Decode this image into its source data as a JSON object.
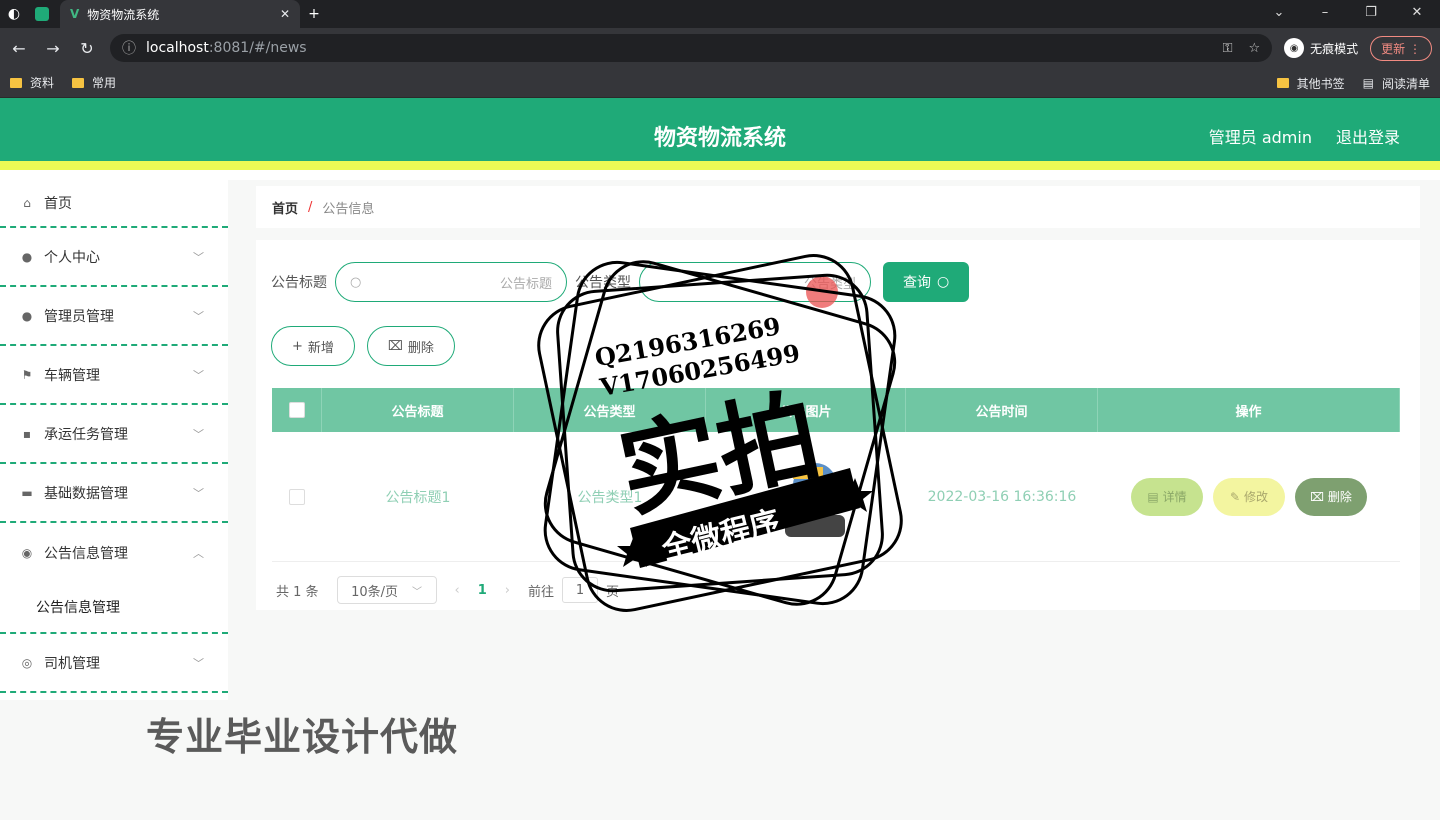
{
  "browser": {
    "tab_title": "物资物流系统",
    "new_tab": "+",
    "url_host": "localhost",
    "url_rest": ":8081/#/news",
    "incognito": "无痕模式",
    "update": "更新",
    "bookmarks": [
      "资料",
      "常用"
    ],
    "bookmarks_right": [
      "其他书签",
      "阅读清单"
    ]
  },
  "header": {
    "title": "物资物流系统",
    "user": "管理员 admin",
    "logout": "退出登录"
  },
  "sidebar": {
    "items": [
      {
        "label": "首页",
        "icon": "home-icon"
      },
      {
        "label": "个人中心",
        "icon": "user-icon"
      },
      {
        "label": "管理员管理",
        "icon": "admin-icon"
      },
      {
        "label": "车辆管理",
        "icon": "flag-icon"
      },
      {
        "label": "承运任务管理",
        "icon": "chat-icon"
      },
      {
        "label": "基础数据管理",
        "icon": "box-icon"
      },
      {
        "label": "公告信息管理",
        "icon": "bulb-icon"
      }
    ],
    "sub_item": "公告信息管理",
    "last_item": {
      "label": "司机管理",
      "icon": "compass-icon"
    }
  },
  "breadcrumb": {
    "home": "首页",
    "sep": "/",
    "current": "公告信息"
  },
  "search": {
    "label1": "公告标题",
    "placeholder1": "公告标题",
    "label2": "公告类型",
    "placeholder2": "公告类型",
    "query": "查询"
  },
  "actions": {
    "add": "新增",
    "delete": "删除"
  },
  "table": {
    "headers": [
      "公告标题",
      "公告类型",
      "公告图片",
      "公告时间",
      "操作"
    ],
    "rows": [
      {
        "title": "公告标题1",
        "type": "公告类型1",
        "time": "2022-03-16 16:36:16"
      }
    ],
    "op_detail": "详情",
    "op_edit": "修改",
    "op_delete": "删除"
  },
  "pagination": {
    "total": "共 1 条",
    "page_size": "10条/页",
    "current": "1",
    "goto": "前往",
    "goto_value": "1",
    "page_unit": "页"
  },
  "watermark": {
    "line1": "Q2196316269",
    "line2": "V17060256499",
    "big": "实拍",
    "ribbon": "全微程序",
    "promo": "专业毕业设计代做"
  }
}
